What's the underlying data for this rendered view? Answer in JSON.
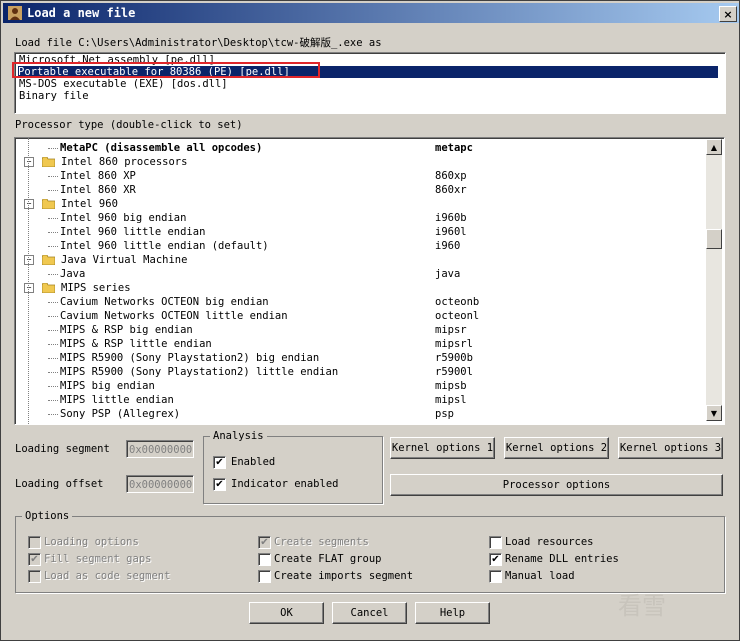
{
  "window": {
    "title": "Load a new file",
    "close": "×"
  },
  "load_file_label": "Load file C:\\Users\\Administrator\\Desktop\\tcw-破解版_.exe as",
  "file_types": [
    "Microsoft.Net assembly [pe.dll]",
    "Portable executable for 80386 (PE) [pe.dll]",
    "MS-DOS executable (EXE) [dos.dll]",
    "Binary file"
  ],
  "processor_label": "Processor type (double-click to set)",
  "processors": [
    {
      "name": "MetaPC (disassemble all opcodes)",
      "code": "metapc",
      "kind": "item",
      "bold": true
    },
    {
      "name": "Intel 860 processors",
      "code": "",
      "kind": "folder"
    },
    {
      "name": "Intel 860 XP",
      "code": "860xp",
      "kind": "item"
    },
    {
      "name": "Intel 860 XR",
      "code": "860xr",
      "kind": "item"
    },
    {
      "name": "Intel 960",
      "code": "",
      "kind": "folder"
    },
    {
      "name": "Intel 960 big endian",
      "code": "i960b",
      "kind": "item"
    },
    {
      "name": "Intel 960 little endian",
      "code": "i960l",
      "kind": "item"
    },
    {
      "name": "Intel 960 little endian (default)",
      "code": "i960",
      "kind": "item"
    },
    {
      "name": "Java Virtual Machine",
      "code": "",
      "kind": "folder"
    },
    {
      "name": "Java",
      "code": "java",
      "kind": "item"
    },
    {
      "name": "MIPS series",
      "code": "",
      "kind": "folder"
    },
    {
      "name": "Cavium Networks OCTEON big endian",
      "code": "octeonb",
      "kind": "item"
    },
    {
      "name": "Cavium Networks OCTEON little endian",
      "code": "octeonl",
      "kind": "item"
    },
    {
      "name": "MIPS & RSP big endian",
      "code": "mipsr",
      "kind": "item"
    },
    {
      "name": "MIPS & RSP little endian",
      "code": "mipsrl",
      "kind": "item"
    },
    {
      "name": "MIPS R5900 (Sony Playstation2) big endian",
      "code": "r5900b",
      "kind": "item"
    },
    {
      "name": "MIPS R5900 (Sony Playstation2) little endian",
      "code": "r5900l",
      "kind": "item"
    },
    {
      "name": "MIPS big endian",
      "code": "mipsb",
      "kind": "item"
    },
    {
      "name": "MIPS little endian",
      "code": "mipsl",
      "kind": "item"
    },
    {
      "name": "Sony PSP (Allegrex)",
      "code": "psp",
      "kind": "item"
    }
  ],
  "loading_segment": {
    "label": "Loading segment",
    "value": "0x00000000"
  },
  "loading_offset": {
    "label": "Loading offset",
    "value": "0x00000000"
  },
  "analysis": {
    "title": "Analysis",
    "enabled": "Enabled",
    "indicator": "Indicator enabled"
  },
  "kernel_buttons": [
    "Kernel options 1",
    "Kernel options 2",
    "Kernel options 3"
  ],
  "processor_options": "Processor options",
  "options": {
    "title": "Options",
    "col1": [
      {
        "label": "Loading options",
        "checked": false,
        "disabled": true
      },
      {
        "label": "Fill segment gaps",
        "checked": true,
        "disabled": true
      },
      {
        "label": "Load as code segment",
        "checked": false,
        "disabled": true
      }
    ],
    "col2": [
      {
        "label": "Create segments",
        "checked": true,
        "disabled": true
      },
      {
        "label": "Create FLAT group",
        "checked": false,
        "disabled": false
      },
      {
        "label": "Create imports segment",
        "checked": false,
        "disabled": false
      }
    ],
    "col3": [
      {
        "label": "Load resources",
        "checked": false,
        "disabled": false
      },
      {
        "label": "Rename DLL entries",
        "checked": true,
        "disabled": false
      },
      {
        "label": "Manual load",
        "checked": false,
        "disabled": false
      }
    ]
  },
  "buttons": {
    "ok": "OK",
    "cancel": "Cancel",
    "help": "Help"
  },
  "watermark": "看雪",
  "colors": {
    "titlebar_start": "#0a246a",
    "titlebar_end": "#a6caf0",
    "highlight": "#0a246a",
    "annotation": "#e0262a",
    "face": "#d4d0c8"
  },
  "icons": {
    "app": "ida-icon",
    "folder": "folder-icon",
    "check": "checkmark-icon"
  }
}
